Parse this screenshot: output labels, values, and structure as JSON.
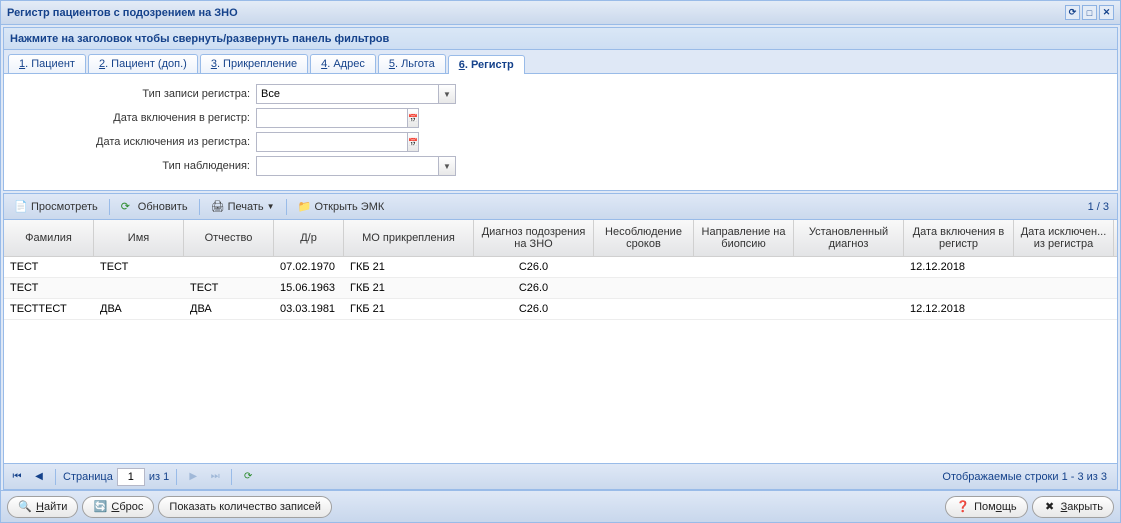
{
  "window": {
    "title": "Регистр пациентов с подозрением на ЗНО"
  },
  "filter": {
    "header": "Нажмите на заголовок чтобы свернуть/развернуть панель фильтров",
    "tabs": [
      {
        "underline": "1",
        "label": ". Пациент"
      },
      {
        "underline": "2",
        "label": ". Пациент (доп.)"
      },
      {
        "underline": "3",
        "label": ". Прикрепление"
      },
      {
        "underline": "4",
        "label": ". Адрес"
      },
      {
        "underline": "5",
        "label": ". Льгота"
      },
      {
        "underline": "6",
        "label": ". Регистр"
      }
    ],
    "active_tab": 5,
    "form": {
      "record_type_label": "Тип записи регистра:",
      "record_type_value": "Все",
      "date_in_label": "Дата включения в регистр:",
      "date_in_value": "",
      "date_out_label": "Дата исключения из регистра:",
      "date_out_value": "",
      "obs_type_label": "Тип наблюдения:",
      "obs_type_value": ""
    }
  },
  "toolbar": {
    "view": "Просмотреть",
    "refresh": "Обновить",
    "print": "Печать",
    "open_emk": "Открыть ЭМК",
    "counter": "1 / 3"
  },
  "grid": {
    "columns": [
      "Фамилия",
      "Имя",
      "Отчество",
      "Д/р",
      "МО прикрепления",
      "Диагноз подозрения на ЗНО",
      "Несоблюдение сроков",
      "Направление на биопсию",
      "Установленный диагноз",
      "Дата включения в регистр",
      "Дата исключен... из регистра"
    ],
    "rows": [
      {
        "cells": [
          "ТЕСТ",
          "ТЕСТ",
          "",
          "07.02.1970",
          "ГКБ 21",
          "C26.0",
          "",
          "",
          "",
          "12.12.2018",
          ""
        ]
      },
      {
        "cells": [
          "ТЕСТ",
          "",
          "ТЕСТ",
          "15.06.1963",
          "ГКБ 21",
          "C26.0",
          "",
          "",
          "",
          "",
          ""
        ]
      },
      {
        "cells": [
          "ТЕСТТЕСТ",
          "ДВА",
          "ДВА",
          "03.03.1981",
          "ГКБ 21",
          "C26.0",
          "",
          "",
          "",
          "12.12.2018",
          ""
        ]
      }
    ]
  },
  "pager": {
    "page_label": "Страница",
    "page_value": "1",
    "of_label": "из 1",
    "display": "Отображаемые строки 1 - 3 из 3"
  },
  "buttons": {
    "find_u": "Н",
    "find": "айти",
    "reset_u": "С",
    "reset": "брос",
    "show_count": "Показать количество записей",
    "help_u": "о",
    "help_pre": "Пом",
    "help_post": "щь",
    "close_u": "З",
    "close": "акрыть"
  }
}
